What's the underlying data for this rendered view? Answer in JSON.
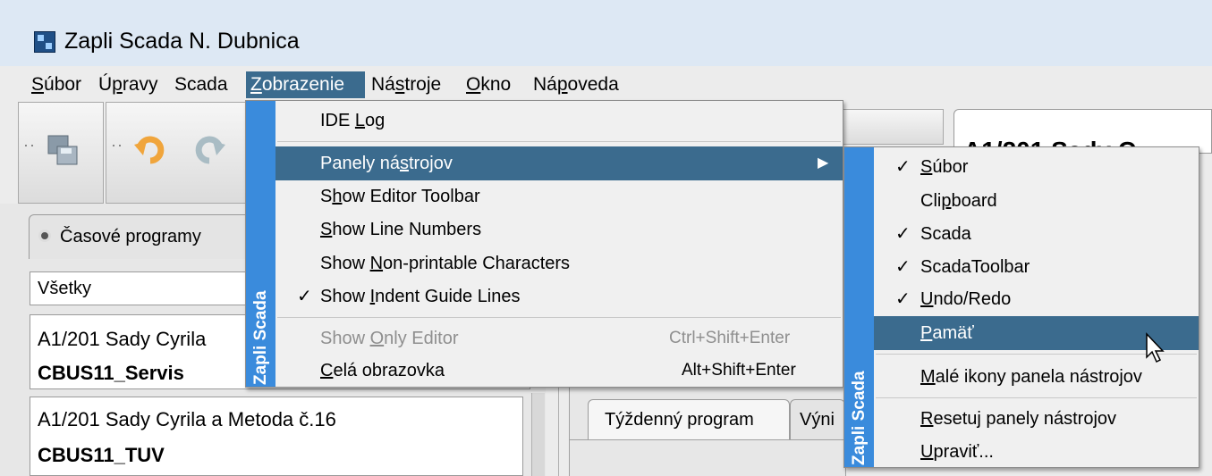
{
  "window": {
    "title": "Zapli Scada N. Dubnica"
  },
  "menubar": [
    {
      "pre": "",
      "u": "S",
      "post": "úbor"
    },
    {
      "pre": "Ú",
      "u": "p",
      "post": "ravy"
    },
    {
      "pre": "Scada",
      "u": "",
      "post": ""
    },
    {
      "pre": "",
      "u": "Z",
      "post": "obrazenie"
    },
    {
      "pre": "Ná",
      "u": "s",
      "post": "troje"
    },
    {
      "pre": "",
      "u": "O",
      "post": "kno"
    },
    {
      "pre": "Ná",
      "u": "p",
      "post": "oveda"
    }
  ],
  "left_panel": {
    "tab_label": "Časové programy",
    "filter_value": "Všetky",
    "items": [
      {
        "line1": "A1/201 Sady Cyrila",
        "line2": "CBUS11_Servis"
      },
      {
        "line1": "A1/201 Sady Cyrila a Metoda č.16",
        "line2": "CBUS11_TUV"
      }
    ]
  },
  "right_panel": {
    "header_text": "A1/201 Sady C",
    "tabs": [
      "Týždenný program",
      "Výni"
    ]
  },
  "zobrazenie_menu": {
    "strip_label": "Zapli Scada",
    "items": [
      {
        "pre": "IDE ",
        "u": "L",
        "post": "og",
        "check": "",
        "accel": "",
        "disabled": false,
        "highlight": false
      },
      {
        "pre": "Panely ná",
        "u": "s",
        "post": "trojov",
        "check": "",
        "accel": "",
        "disabled": false,
        "highlight": true,
        "submenu": true
      },
      {
        "pre": "S",
        "u": "h",
        "post": "ow Editor Toolbar",
        "check": "",
        "accel": "",
        "disabled": false,
        "highlight": false
      },
      {
        "pre": "",
        "u": "S",
        "post": "how Line Numbers",
        "check": "",
        "accel": "",
        "disabled": false,
        "highlight": false
      },
      {
        "pre": "Show ",
        "u": "N",
        "post": "on-printable Characters",
        "check": "",
        "accel": "",
        "disabled": false,
        "highlight": false
      },
      {
        "pre": "Show ",
        "u": "I",
        "post": "ndent Guide Lines",
        "check": "✓",
        "accel": "",
        "disabled": false,
        "highlight": false
      },
      {
        "pre": "Show ",
        "u": "O",
        "post": "nly Editor",
        "check": "",
        "accel": "Ctrl+Shift+Enter",
        "disabled": true,
        "highlight": false
      },
      {
        "pre": "",
        "u": "C",
        "post": "elá obrazovka",
        "check": "",
        "accel": "Alt+Shift+Enter",
        "disabled": false,
        "highlight": false
      }
    ]
  },
  "panely_submenu": {
    "strip_label": "Zapli Scada",
    "items": [
      {
        "pre": "",
        "u": "S",
        "post": "úbor",
        "check": "✓",
        "highlight": false
      },
      {
        "pre": "Cli",
        "u": "p",
        "post": "board",
        "check": "",
        "highlight": false
      },
      {
        "pre": "Scada",
        "u": "",
        "post": "",
        "check": "✓",
        "highlight": false
      },
      {
        "pre": "ScadaToolbar",
        "u": "",
        "post": "",
        "check": "✓",
        "highlight": false
      },
      {
        "pre": "",
        "u": "U",
        "post": "ndo/Redo",
        "check": "✓",
        "highlight": false
      },
      {
        "pre": "",
        "u": "P",
        "post": "amäť",
        "check": "",
        "highlight": true
      },
      {
        "pre": "",
        "u": "M",
        "post": "alé ikony panela nástrojov",
        "check": "",
        "highlight": false
      },
      {
        "pre": "",
        "u": "R",
        "post": "esetuj panely nástrojov",
        "check": "",
        "highlight": false
      },
      {
        "pre": "",
        "u": "U",
        "post": "praviť...",
        "check": "",
        "highlight": false
      }
    ]
  }
}
